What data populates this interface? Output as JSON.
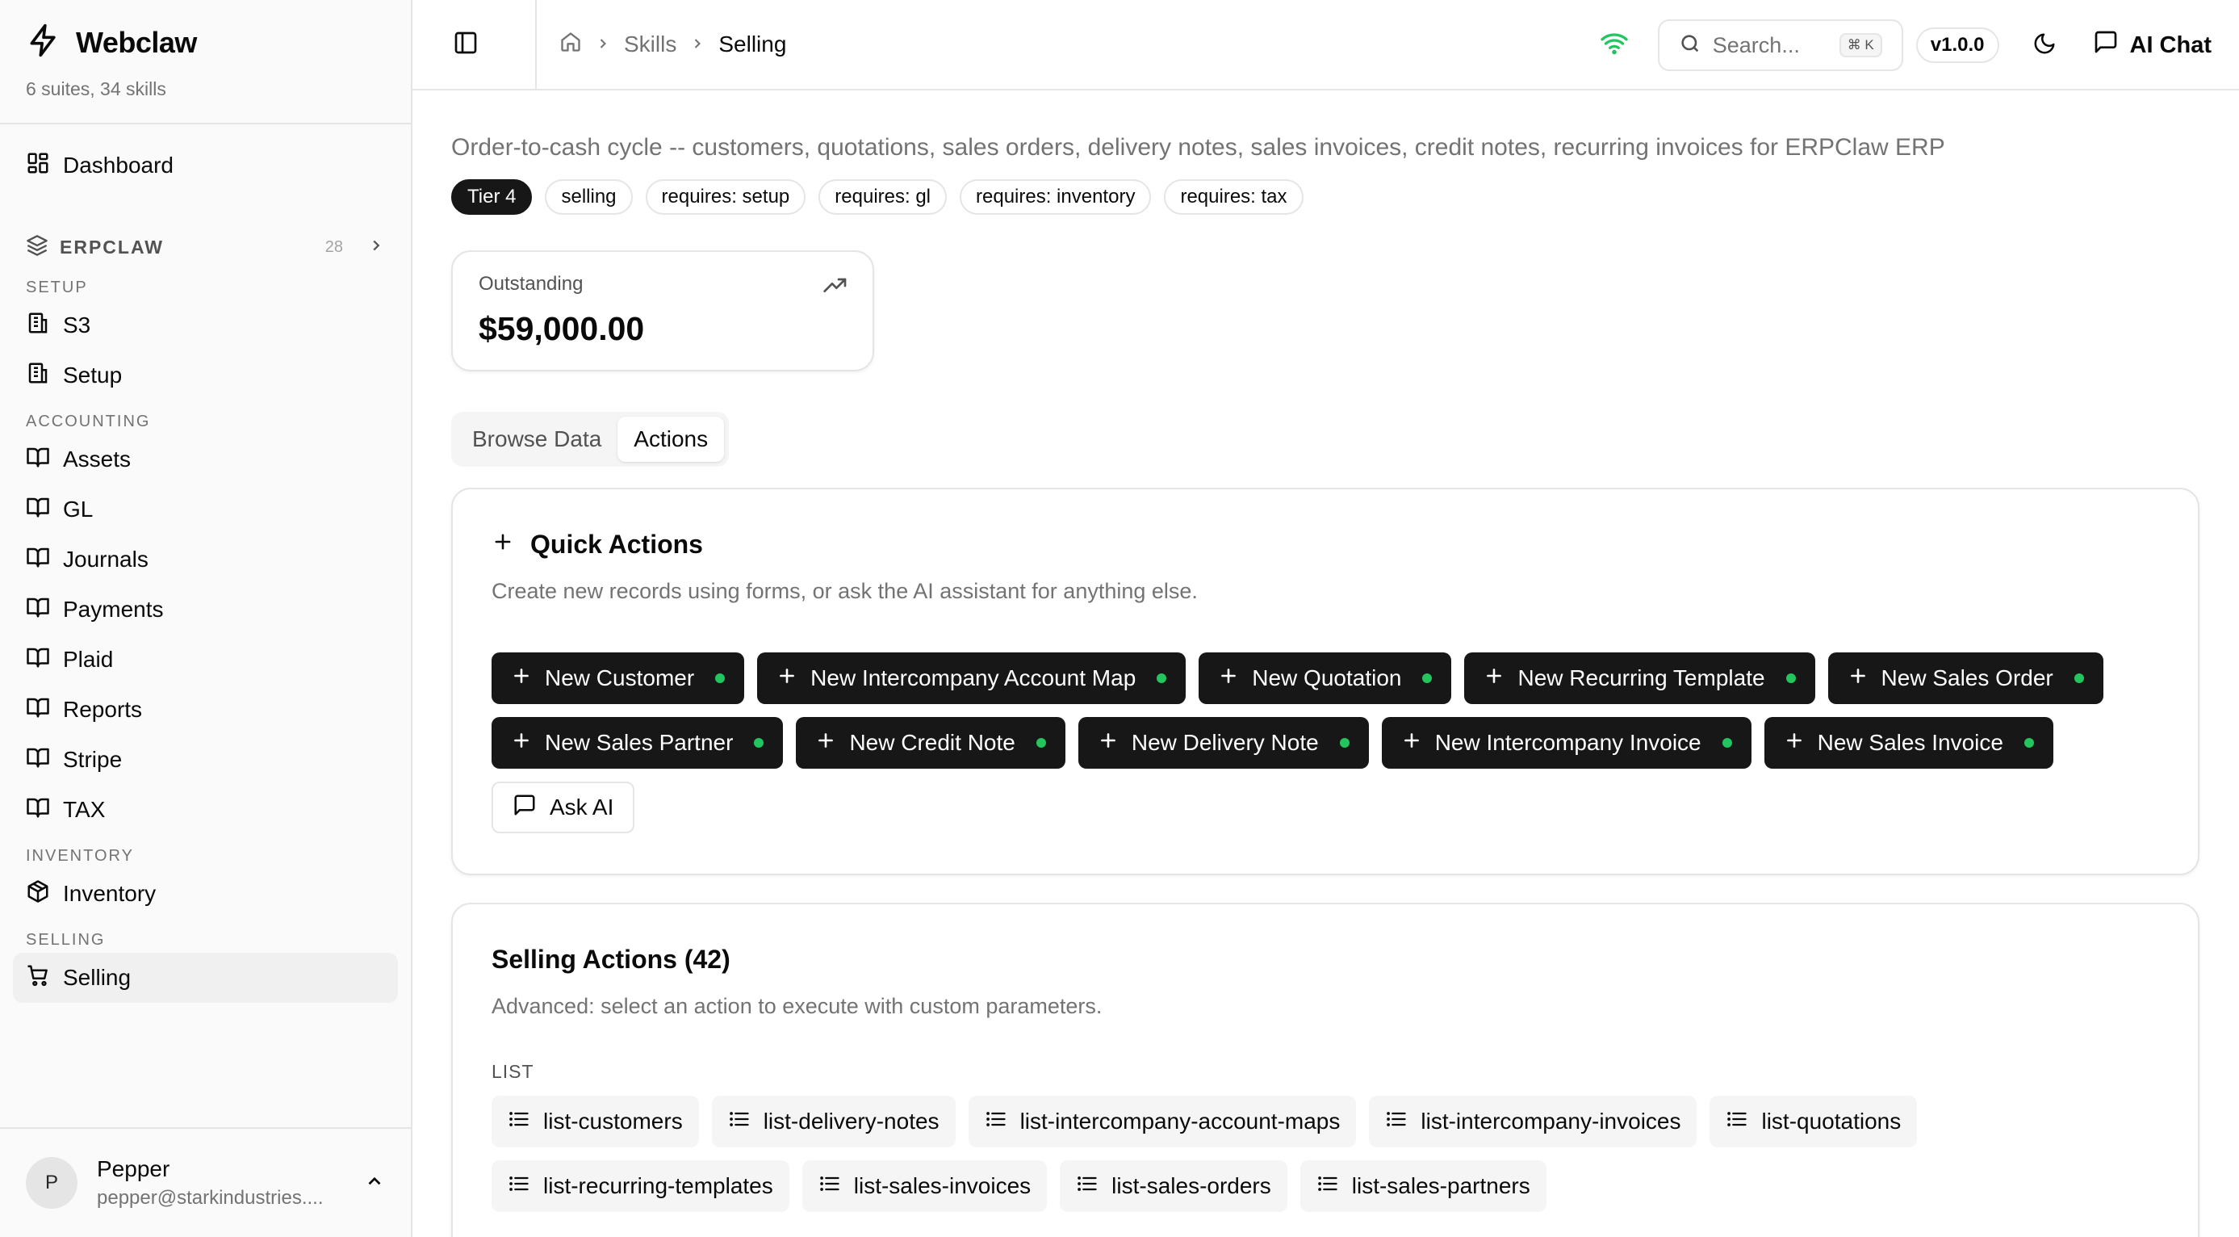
{
  "brand": {
    "name": "Webclaw",
    "subtitle": "6 suites, 34 skills"
  },
  "sidebar": {
    "dashboard": "Dashboard",
    "suite": {
      "name": "ERPCLAW",
      "count": "28"
    },
    "sections": {
      "setup": "SETUP",
      "accounting": "ACCOUNTING",
      "inventory": "INVENTORY",
      "selling": "SELLING"
    },
    "setup_items": [
      "S3",
      "Setup"
    ],
    "accounting_items": [
      "Assets",
      "GL",
      "Journals",
      "Payments",
      "Plaid",
      "Reports",
      "Stripe",
      "TAX"
    ],
    "inventory_items": [
      "Inventory"
    ],
    "selling_items": [
      "Selling"
    ]
  },
  "user": {
    "initial": "P",
    "name": "Pepper",
    "email": "pepper@starkindustries...."
  },
  "topbar": {
    "breadcrumb": [
      "Skills",
      "Selling"
    ],
    "search_placeholder": "Search...",
    "shortcut": "⌘ K",
    "version": "v1.0.0",
    "ai_chat": "AI Chat",
    "status_color": "#22c55e"
  },
  "page": {
    "description": "Order-to-cash cycle -- customers, quotations, sales orders, delivery notes, sales invoices, credit notes, recurring invoices for ERPClaw ERP",
    "tags": [
      "Tier 4",
      "selling",
      "requires: setup",
      "requires: gl",
      "requires: inventory",
      "requires: tax"
    ]
  },
  "stat": {
    "label": "Outstanding",
    "value": "$59,000.00"
  },
  "tabs": [
    "Browse Data",
    "Actions"
  ],
  "quick_actions": {
    "title": "Quick Actions",
    "subtitle": "Create new records using forms, or ask the AI assistant for anything else.",
    "buttons": [
      "New Customer",
      "New Intercompany Account Map",
      "New Quotation",
      "New Recurring Template",
      "New Sales Order",
      "New Sales Partner",
      "New Credit Note",
      "New Delivery Note",
      "New Intercompany Invoice",
      "New Sales Invoice"
    ],
    "ask_ai": "Ask AI"
  },
  "selling_actions": {
    "title": "Selling Actions (42)",
    "subtitle": "Advanced: select an action to execute with custom parameters.",
    "group_label": "LIST",
    "list_actions": [
      "list-customers",
      "list-delivery-notes",
      "list-intercompany-account-maps",
      "list-intercompany-invoices",
      "list-quotations",
      "list-recurring-templates",
      "list-sales-invoices",
      "list-sales-orders",
      "list-sales-partners"
    ]
  }
}
